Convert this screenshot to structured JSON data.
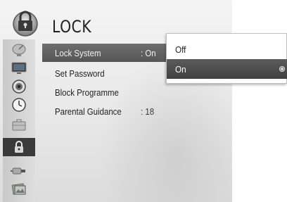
{
  "header": {
    "title": "LOCK",
    "icon": "padlock-icon"
  },
  "sidebar": {
    "items": [
      {
        "name": "sidebar-item-satellite",
        "icon": "satellite-dish-icon"
      },
      {
        "name": "sidebar-item-picture",
        "icon": "monitor-icon"
      },
      {
        "name": "sidebar-item-audio",
        "icon": "speaker-icon"
      },
      {
        "name": "sidebar-item-time",
        "icon": "clock-icon"
      },
      {
        "name": "sidebar-item-option",
        "icon": "briefcase-icon"
      },
      {
        "name": "sidebar-item-lock",
        "icon": "padlock-icon",
        "active": true
      },
      {
        "name": "sidebar-item-input",
        "icon": "plug-icon"
      },
      {
        "name": "sidebar-item-media",
        "icon": "photo-icon"
      }
    ]
  },
  "menu": {
    "items": [
      {
        "label": "Lock System",
        "value": ": On",
        "selected": true
      },
      {
        "label": "Set Password",
        "value": ""
      },
      {
        "label": "Block Programme",
        "value": ""
      },
      {
        "label": "Parental Guidance",
        "value": ": 18"
      }
    ]
  },
  "popup": {
    "options": [
      {
        "label": "Off",
        "selected": false
      },
      {
        "label": "On",
        "selected": true
      }
    ]
  },
  "colors": {
    "selection": "#555555",
    "background": "#ececec",
    "text": "#1f1f1f"
  }
}
